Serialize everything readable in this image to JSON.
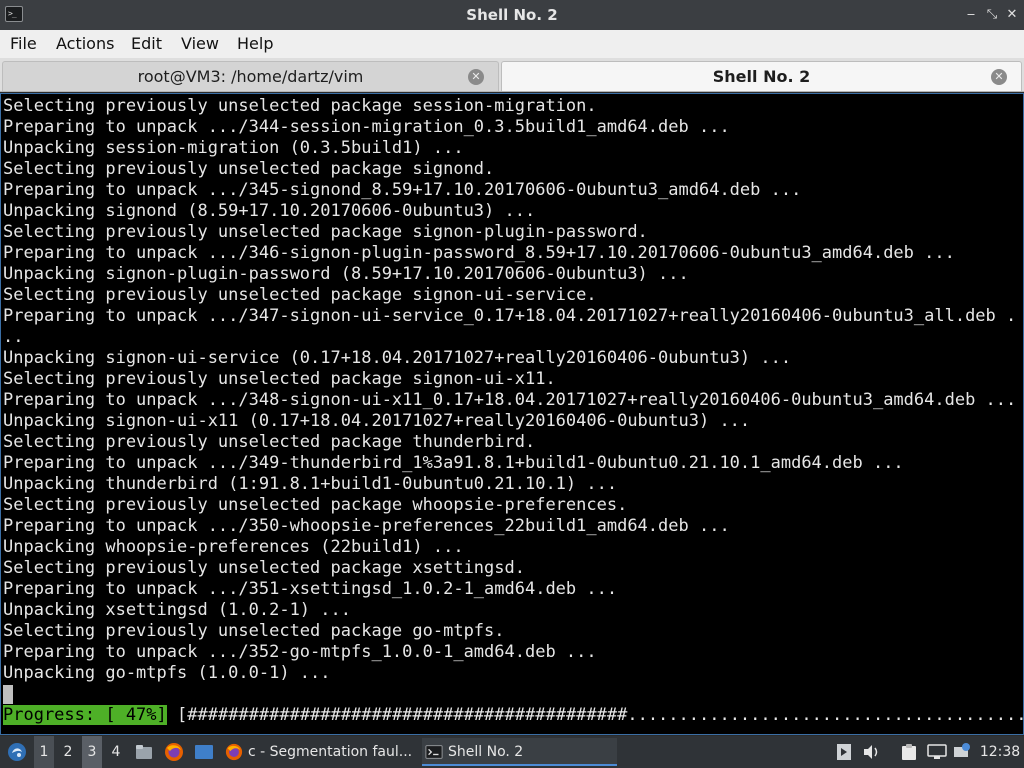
{
  "window": {
    "title": "Shell No. 2",
    "app_icon_glyph": ">_",
    "buttons": {
      "minimize": "‒",
      "restore": "⤡",
      "close": "✕"
    }
  },
  "menubar": {
    "items": [
      {
        "label": "File"
      },
      {
        "label": "Actions"
      },
      {
        "label": "Edit"
      },
      {
        "label": "View"
      },
      {
        "label": "Help"
      }
    ]
  },
  "tabs": [
    {
      "label": "root@VM3: /home/dartz/vim",
      "active": false,
      "close_glyph": "✕"
    },
    {
      "label": "Shell No. 2",
      "active": true,
      "close_glyph": "✕"
    }
  ],
  "terminal": {
    "lines": [
      "Selecting previously unselected package session-migration.",
      "Preparing to unpack .../344-session-migration_0.3.5build1_amd64.deb ...",
      "Unpacking session-migration (0.3.5build1) ...",
      "Selecting previously unselected package signond.",
      "Preparing to unpack .../345-signond_8.59+17.10.20170606-0ubuntu3_amd64.deb ...",
      "Unpacking signond (8.59+17.10.20170606-0ubuntu3) ...",
      "Selecting previously unselected package signon-plugin-password.",
      "Preparing to unpack .../346-signon-plugin-password_8.59+17.10.20170606-0ubuntu3_amd64.deb ...",
      "Unpacking signon-plugin-password (8.59+17.10.20170606-0ubuntu3) ...",
      "Selecting previously unselected package signon-ui-service.",
      "Preparing to unpack .../347-signon-ui-service_0.17+18.04.20171027+really20160406-0ubuntu3_all.deb .",
      "..",
      "Unpacking signon-ui-service (0.17+18.04.20171027+really20160406-0ubuntu3) ...",
      "Selecting previously unselected package signon-ui-x11.",
      "Preparing to unpack .../348-signon-ui-x11_0.17+18.04.20171027+really20160406-0ubuntu3_amd64.deb ...",
      "Unpacking signon-ui-x11 (0.17+18.04.20171027+really20160406-0ubuntu3) ...",
      "Selecting previously unselected package thunderbird.",
      "Preparing to unpack .../349-thunderbird_1%3a91.8.1+build1-0ubuntu0.21.10.1_amd64.deb ...",
      "Unpacking thunderbird (1:91.8.1+build1-0ubuntu0.21.10.1) ...",
      "Selecting previously unselected package whoopsie-preferences.",
      "Preparing to unpack .../350-whoopsie-preferences_22build1_amd64.deb ...",
      "Unpacking whoopsie-preferences (22build1) ...",
      "Selecting previously unselected package xsettingsd.",
      "Preparing to unpack .../351-xsettingsd_1.0.2-1_amd64.deb ...",
      "Unpacking xsettingsd (1.0.2-1) ...",
      "Selecting previously unselected package go-mtpfs.",
      "Preparing to unpack .../352-go-mtpfs_1.0.0-1_amd64.deb ...",
      "Unpacking go-mtpfs (1.0.0-1) ..."
    ],
    "progress": {
      "label": "Progress: [ 47%]",
      "bar": "[###########################################.................................................]",
      "percent": 47
    }
  },
  "taskbar": {
    "workspaces": [
      "1",
      "2",
      "3",
      "4"
    ],
    "current_workspace": "1",
    "tasks": [
      {
        "label": "c - Segmentation faul...",
        "icon": "firefox-icon"
      },
      {
        "label": "Shell No. 2",
        "icon": "terminal-icon"
      }
    ],
    "clock": "12:38"
  },
  "colors": {
    "terminal_bg": "#000000",
    "terminal_fg": "#e6e6e6",
    "progress_green": "#4eb027",
    "taskbar_bg": "#2f3337",
    "titlebar_bg": "#3b3e42"
  }
}
